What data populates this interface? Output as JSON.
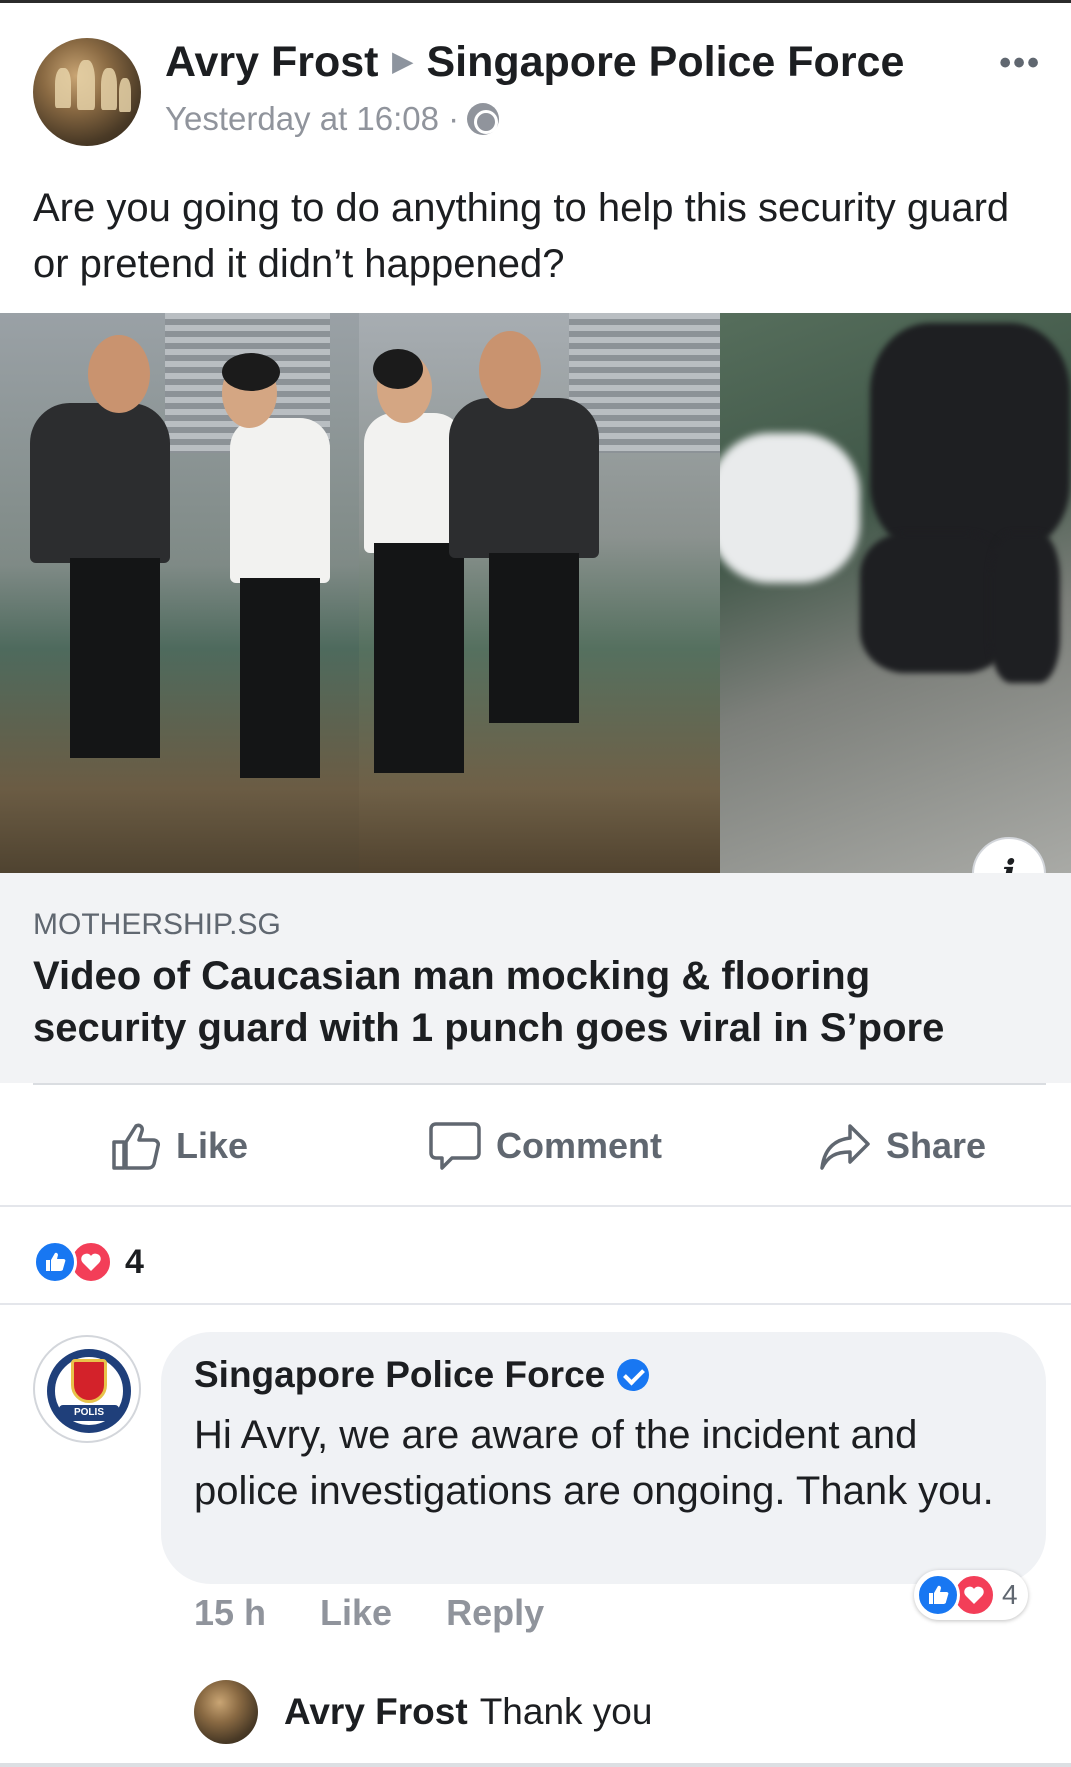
{
  "post": {
    "author": "Avry Frost",
    "target": "Singapore Police Force",
    "timestamp": "Yesterday at 16:08 ·",
    "text": "Are you going to do anything to help this security guard or pretend it didn’t happened?",
    "more_label": "•••"
  },
  "link": {
    "source": "MOTHERSHIP.SG",
    "title": "Video of Caucasian man mocking & flooring security guard with 1 punch goes viral in S’pore",
    "info_label": "i"
  },
  "actions": {
    "like": "Like",
    "comment": "Comment",
    "share": "Share"
  },
  "reactions": {
    "count": "4"
  },
  "comment": {
    "author": "Singapore Police Force",
    "text": "Hi Avry, we are aware of the incident and police investigations are ongoing. Thank you.",
    "time": "15 h",
    "like": "Like",
    "reply": "Reply",
    "reaction_count": "4",
    "avatar_text": "POLIS"
  },
  "reply": {
    "author": "Avry Frost",
    "text": "Thank you"
  },
  "colors": {
    "like_blue": "#1877f2",
    "love_red": "#f33e58",
    "text_dark": "#1c1e21",
    "text_muted": "#90949c"
  }
}
